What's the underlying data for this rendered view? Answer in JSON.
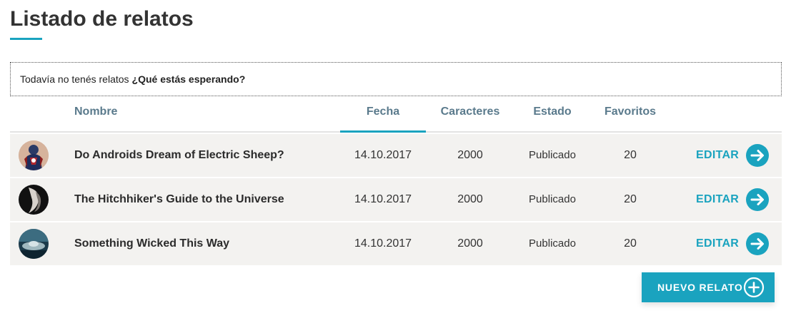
{
  "page": {
    "title": "Listado de relatos",
    "accent_color": "#1aa3bf"
  },
  "notice": {
    "text": "Todavía no tenés relatos",
    "emphasis": "¿Qué estás esperando?"
  },
  "table": {
    "headers": {
      "nombre": "Nombre",
      "fecha": "Fecha",
      "caracteres": "Caracteres",
      "estado": "Estado",
      "favoritos": "Favoritos"
    },
    "active_sort": "fecha",
    "rows": [
      {
        "avatar_icon": "superhero-avatar",
        "name": "Do Androids Dream of Electric Sheep?",
        "fecha": "14.10.2017",
        "caracteres": "2000",
        "estado": "Publicado",
        "favoritos": "20",
        "action": "EDITAR"
      },
      {
        "avatar_icon": "dark-figure-avatar",
        "name": "The Hitchhiker's Guide to the Universe",
        "fecha": "14.10.2017",
        "caracteres": "2000",
        "estado": "Publicado",
        "favoritos": "20",
        "action": "EDITAR"
      },
      {
        "avatar_icon": "spaceship-avatar",
        "name": "Something Wicked This Way",
        "fecha": "14.10.2017",
        "caracteres": "2000",
        "estado": "Publicado",
        "favoritos": "20",
        "action": "EDITAR"
      }
    ]
  },
  "new_button": {
    "label": "NUEVO RELATO",
    "icon": "plus-circle-icon"
  }
}
